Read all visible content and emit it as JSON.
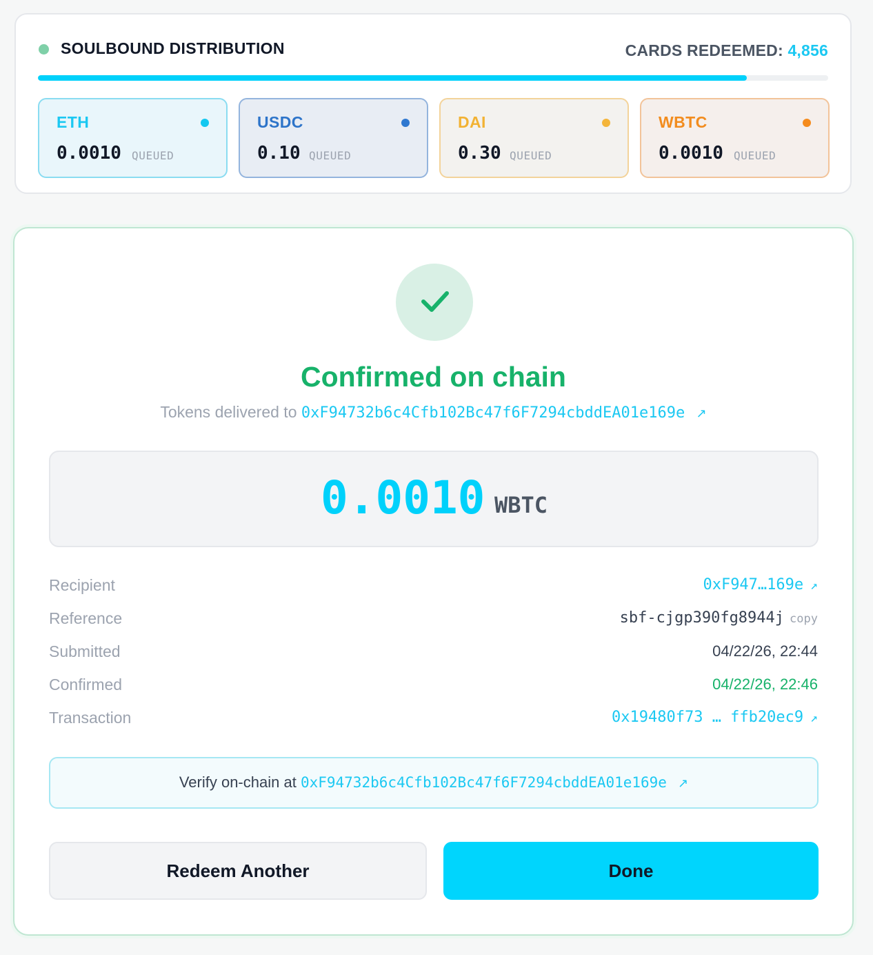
{
  "distribution": {
    "title": "SOULBOUND DISTRIBUTION",
    "redeemed_label": "CARDS REDEEMED:",
    "redeemed_count": "4,856",
    "progress_fraction": 0.897,
    "tokens": [
      {
        "name": "ETH",
        "amount": "0.0010",
        "status": "QUEUED",
        "color": "#1bc8f2",
        "bg": "#e9f6fb",
        "border": "#8adcf1",
        "dot": "#13c8f0"
      },
      {
        "name": "USDC",
        "amount": "0.10",
        "status": "QUEUED",
        "color": "#2d74c9",
        "bg": "#e8edf4",
        "border": "#93b4dd",
        "dot": "#2f78d0"
      },
      {
        "name": "DAI",
        "amount": "0.30",
        "status": "QUEUED",
        "color": "#f2b233",
        "bg": "#f3f2ef",
        "border": "#f3d39a",
        "dot": "#f4b53a"
      },
      {
        "name": "WBTC",
        "amount": "0.0010",
        "status": "QUEUED",
        "color": "#f28c1e",
        "bg": "#f5efec",
        "border": "#f2c399",
        "dot": "#f58b1d"
      }
    ]
  },
  "confirmation": {
    "icon": "checkmark-icon",
    "title": "Confirmed on chain",
    "delivered_prefix": "Tokens delivered to",
    "delivered_address": "0xF94732b6c4Cfb102Bc47f6F7294cbddEA01e169e",
    "external_link_glyph": "↗",
    "amount": "0.0010",
    "unit": "WBTC",
    "details": {
      "recipient_label": "Recipient",
      "recipient_value": "0xF947…169e",
      "reference_label": "Reference",
      "reference_value": "sbf-cjgp390fg8944j",
      "copy_label": "copy",
      "submitted_label": "Submitted",
      "submitted_value": "04/22/26, 22:44",
      "confirmed_label": "Confirmed",
      "confirmed_value": "04/22/26, 22:46",
      "transaction_label": "Transaction",
      "transaction_value": "0x19480f73 … ffb20ec9"
    },
    "verify_prefix": "Verify on-chain at",
    "verify_address": "0xF94732b6c4Cfb102Bc47f6F7294cbddEA01e169e",
    "buttons": {
      "redeem_another": "Redeem Another",
      "done": "Done"
    }
  }
}
